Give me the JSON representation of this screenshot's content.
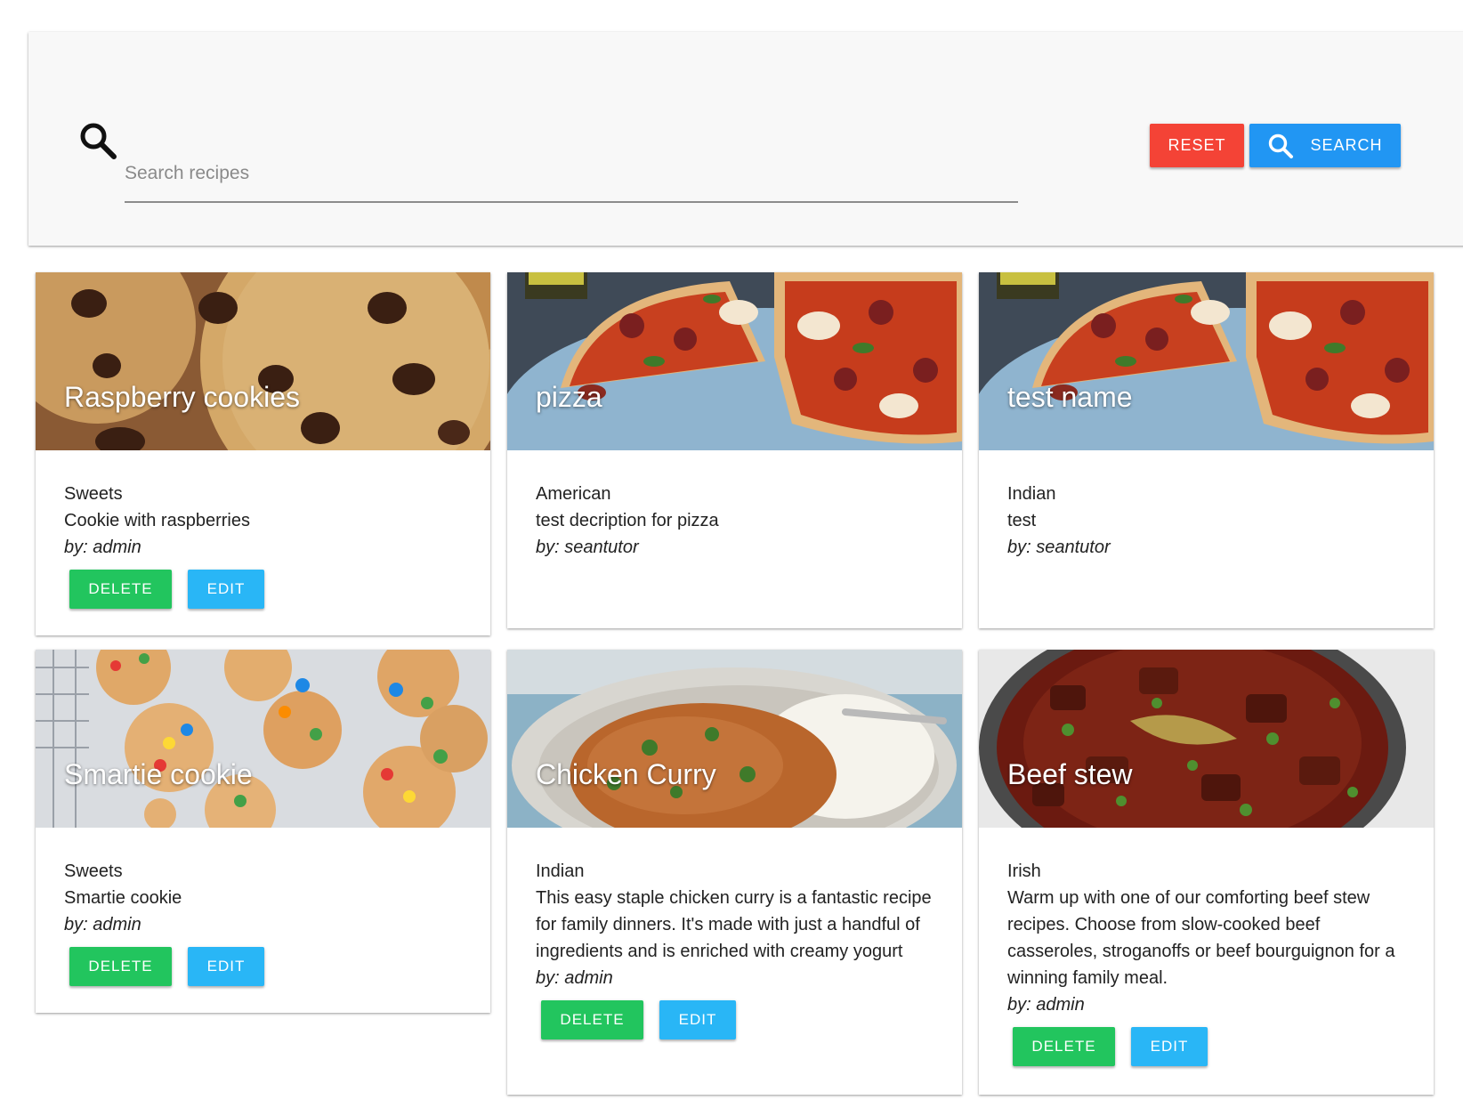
{
  "colors": {
    "reset": "#f44336",
    "search": "#2196f3",
    "delete": "#22c55e",
    "edit": "#29b6f6"
  },
  "search": {
    "icon": "search-icon",
    "placeholder": "Search recipes",
    "value": "",
    "reset_label": "RESET",
    "search_label": "SEARCH"
  },
  "cards": [
    {
      "title": "Raspberry cookies",
      "image": "chocolate-chip-cookies",
      "category": "Sweets",
      "description": "Cookie with raspberries",
      "author": "by: admin",
      "delete_label": "DELETE",
      "edit_label": "EDIT"
    },
    {
      "title": "pizza",
      "image": "pepperoni-pizza",
      "category": "American",
      "description": "test decription for pizza",
      "author": "by: seantutor"
    },
    {
      "title": "test name",
      "image": "pepperoni-pizza",
      "category": "Indian",
      "description": "test",
      "author": "by: seantutor"
    },
    {
      "title": "Smartie cookie",
      "image": "smartie-cookies",
      "category": "Sweets",
      "description": "Smartie cookie",
      "author": "by: admin",
      "delete_label": "DELETE",
      "edit_label": "EDIT"
    },
    {
      "title": "Chicken Curry",
      "image": "chicken-curry",
      "category": "Indian",
      "description": "This easy staple chicken curry is a fantastic recipe for family dinners. It's made with just a handful of ingredients and is enriched with creamy yogurt",
      "author": "by: admin",
      "delete_label": "DELETE",
      "edit_label": "EDIT"
    },
    {
      "title": "Beef stew",
      "image": "beef-stew",
      "category": "Irish",
      "description": "Warm up with one of our comforting beef stew recipes. Choose from slow-cooked beef casseroles, stroganoffs or beef bourguignon for a winning family meal.",
      "author": "by: admin",
      "delete_label": "DELETE",
      "edit_label": "EDIT"
    }
  ]
}
